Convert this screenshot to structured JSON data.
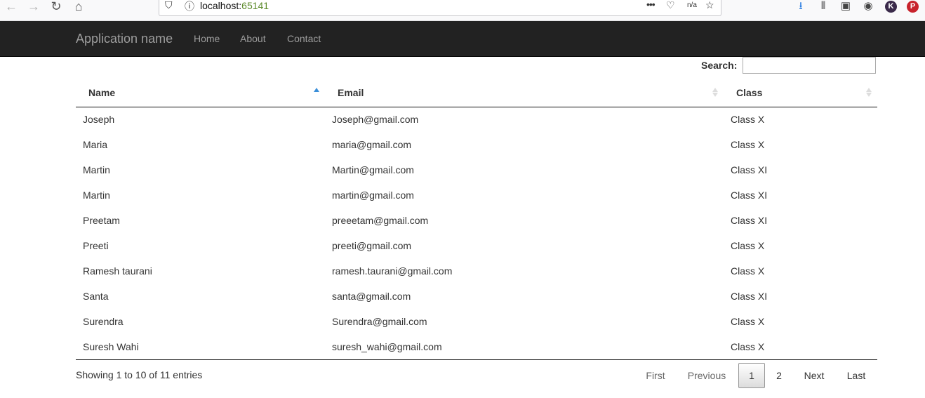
{
  "browser": {
    "url_host": "localhost:",
    "url_port": "65141",
    "page_actions_label": "•••",
    "na_label": "n/a"
  },
  "navbar": {
    "brand": "Application name",
    "links": [
      "Home",
      "About",
      "Contact"
    ]
  },
  "table": {
    "search_label": "Search:",
    "search_value": "",
    "columns": [
      "Name",
      "Email",
      "Class"
    ],
    "rows": [
      [
        "Joseph",
        "Joseph@gmail.com",
        "Class X"
      ],
      [
        "Maria",
        "maria@gmail.com",
        "Class X"
      ],
      [
        "Martin",
        "Martin@gmail.com",
        "Class XI"
      ],
      [
        "Martin",
        "martin@gmail.com",
        "Class XI"
      ],
      [
        "Preetam",
        "preeetam@gmail.com",
        "Class XI"
      ],
      [
        "Preeti",
        "preeti@gmail.com",
        "Class X"
      ],
      [
        "Ramesh taurani",
        "ramesh.taurani@gmail.com",
        "Class X"
      ],
      [
        "Santa",
        "santa@gmail.com",
        "Class XI"
      ],
      [
        "Surendra",
        "Surendra@gmail.com",
        "Class X"
      ],
      [
        "Suresh Wahi",
        "suresh_wahi@gmail.com",
        "Class X"
      ]
    ],
    "info": "Showing 1 to 10 of 11 entries",
    "pagination": {
      "first": "First",
      "previous": "Previous",
      "pages": [
        "1",
        "2"
      ],
      "next": "Next",
      "last": "Last"
    }
  },
  "colors": {
    "navbar_bg": "#222222",
    "nav_text": "#9d9d9d",
    "sort_active": "#3b8fd9"
  }
}
